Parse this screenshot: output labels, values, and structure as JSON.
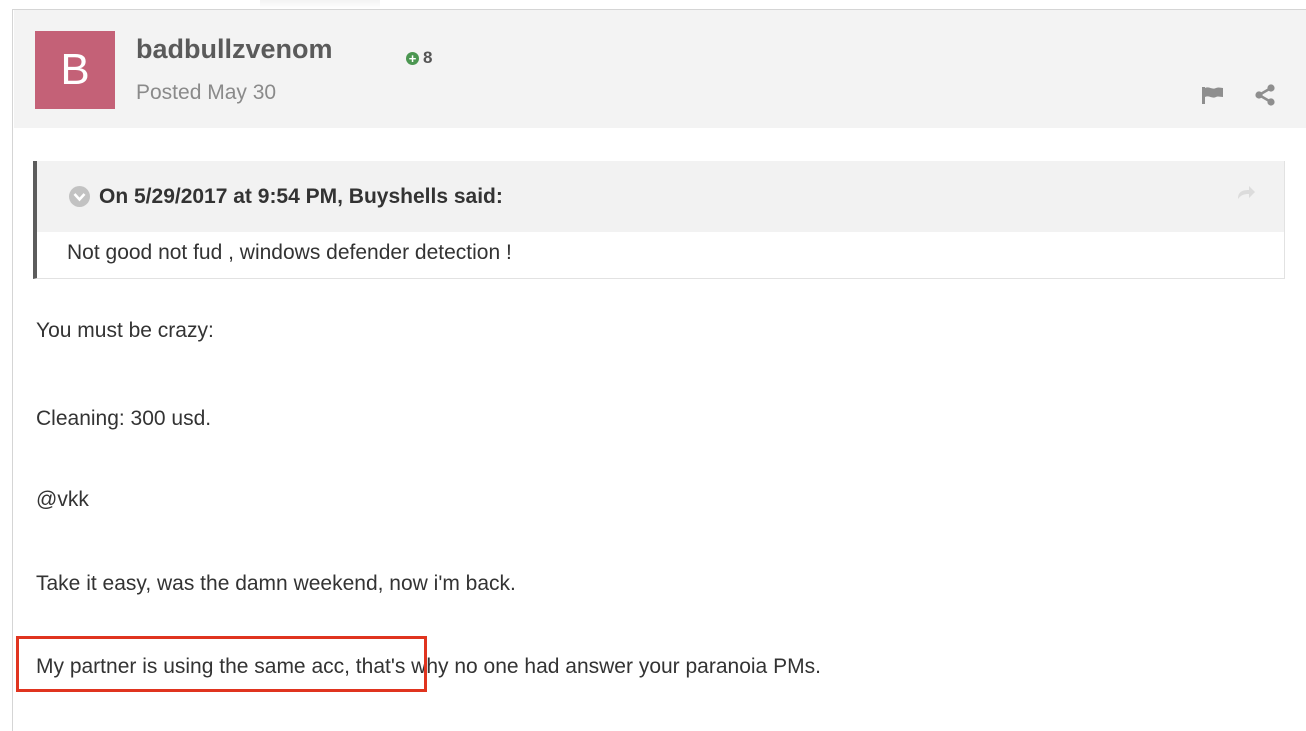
{
  "post": {
    "avatar_letter": "B",
    "username": "badbullzvenom",
    "reputation": "8",
    "posted": "Posted May 30",
    "colors": {
      "avatar": "#c46177",
      "reputation": "#4b9651",
      "highlight": "#e0341f"
    }
  },
  "quote": {
    "citation": "On 5/29/2017 at 9:54 PM, Buyshells said:",
    "text": "Not good not fud , windows defender detection !"
  },
  "body": {
    "p1": "You must be crazy:",
    "p2": "Cleaning: 300 usd.",
    "p3": "@vkk",
    "p4": "Take it easy, was the damn weekend, now i'm back.",
    "p5": "My partner is using the same acc, that's why no one had answer your paranoia PMs."
  },
  "icons": [
    "reputation-plus-icon",
    "flag-icon",
    "share-icon",
    "quote-toggle-icon",
    "quote-goto-icon"
  ]
}
